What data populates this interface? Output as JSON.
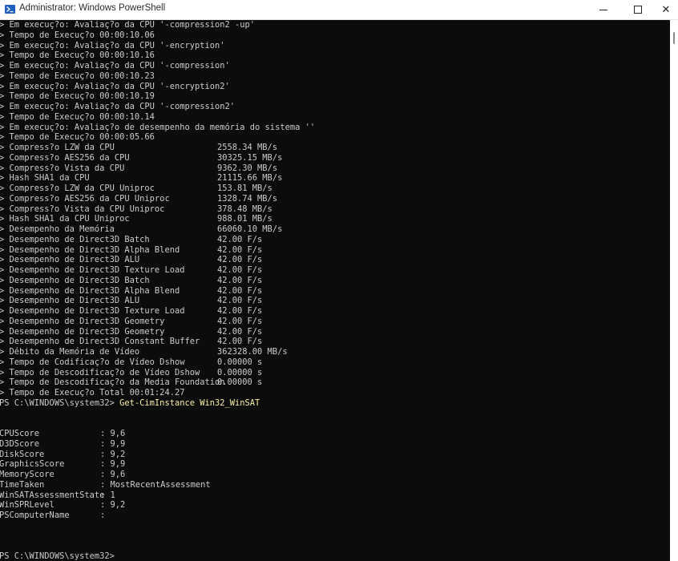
{
  "window": {
    "title": "Administrator: Windows PowerShell",
    "icon": "powershell-icon",
    "controls": {
      "minimize": "minimize-icon",
      "maximize": "maximize-icon",
      "close": "✕"
    }
  },
  "console": {
    "text_color": "#cccccc",
    "background": "#0c0c0c",
    "command_color": "#f9f1a5",
    "log_lines": [
      "> Em execuç?o: Avaliaç?o da CPU '-compression2 -up'",
      "> Tempo de Execuç?o 00:00:10.06",
      "> Em execuç?o: Avaliaç?o da CPU '-encryption'",
      "> Tempo de Execuç?o 00:00:10.16",
      "> Em execuç?o: Avaliaç?o da CPU '-compression'",
      "> Tempo de Execuç?o 00:00:10.23",
      "> Em execuç?o: Avaliaç?o da CPU '-encryption2'",
      "> Tempo de Execuç?o 00:00:10.19",
      "> Em execuç?o: Avaliaç?o da CPU '-compression2'",
      "> Tempo de Execuç?o 00:00:10.14",
      "> Em execuç?o: Avaliaç?o de desempenho da memória do sistema ''",
      "> Tempo de Execuç?o 00:00:05.66"
    ],
    "results": [
      {
        "label": "> Compress?o LZW da CPU",
        "value": "2558.34 MB/s"
      },
      {
        "label": "> Compress?o AES256 da CPU",
        "value": "30325.15 MB/s"
      },
      {
        "label": "> Compress?o Vista da CPU",
        "value": "9362.30 MB/s"
      },
      {
        "label": "> Hash SHA1 da CPU",
        "value": "21115.66 MB/s"
      },
      {
        "label": "> Compress?o LZW da CPU Uniproc",
        "value": "153.81 MB/s"
      },
      {
        "label": "> Compress?o AES256 da CPU Uniproc",
        "value": "1328.74 MB/s"
      },
      {
        "label": "> Compress?o Vista da CPU Uniproc",
        "value": "378.48 MB/s"
      },
      {
        "label": "> Hash SHA1 da CPU Uniproc",
        "value": "988.01 MB/s"
      },
      {
        "label": "> Desempenho da Memória",
        "value": "66060.10 MB/s"
      },
      {
        "label": "> Desempenho de Direct3D Batch",
        "value": "42.00 F/s"
      },
      {
        "label": "> Desempenho de Direct3D Alpha Blend",
        "value": "42.00 F/s"
      },
      {
        "label": "> Desempenho de Direct3D ALU",
        "value": "42.00 F/s"
      },
      {
        "label": "> Desempenho de Direct3D Texture Load",
        "value": "42.00 F/s"
      },
      {
        "label": "> Desempenho de Direct3D Batch",
        "value": "42.00 F/s"
      },
      {
        "label": "> Desempenho de Direct3D Alpha Blend",
        "value": "42.00 F/s"
      },
      {
        "label": "> Desempenho de Direct3D ALU",
        "value": "42.00 F/s"
      },
      {
        "label": "> Desempenho de Direct3D Texture Load",
        "value": "42.00 F/s"
      },
      {
        "label": "> Desempenho de Direct3D Geometry",
        "value": "42.00 F/s"
      },
      {
        "label": "> Desempenho de Direct3D Geometry",
        "value": "42.00 F/s"
      },
      {
        "label": "> Desempenho de Direct3D Constant Buffer",
        "value": "42.00 F/s"
      },
      {
        "label": "> Débito da Memória de Vídeo",
        "value": "362328.00 MB/s"
      },
      {
        "label": "> Tempo de Codificaç?o de Vídeo Dshow",
        "value": "0.00000 s"
      },
      {
        "label": "> Tempo de Descodificaç?o de Vídeo Dshow",
        "value": "0.00000 s"
      },
      {
        "label": "> Tempo de Descodificaç?o da Media Foundation",
        "value": "0.00000 s"
      }
    ],
    "total_time": "> Tempo de Execuç?o Total 00:01:24.27",
    "prompt_command": {
      "prompt": "PS C:\\WINDOWS\\system32> ",
      "command": "Get-CimInstance Win32_WinSAT"
    },
    "properties": [
      {
        "name": "CPUScore",
        "value": "9,6"
      },
      {
        "name": "D3DScore",
        "value": "9,9"
      },
      {
        "name": "DiskScore",
        "value": "9,2"
      },
      {
        "name": "GraphicsScore",
        "value": "9,9"
      },
      {
        "name": "MemoryScore",
        "value": "9,6"
      },
      {
        "name": "TimeTaken",
        "value": "MostRecentAssessment"
      },
      {
        "name": "WinSATAssessmentState",
        "value": "1"
      },
      {
        "name": "WinSPRLevel",
        "value": "9,2"
      },
      {
        "name": "PSComputerName",
        "value": ""
      }
    ],
    "final_prompt": "PS C:\\WINDOWS\\system32>"
  }
}
